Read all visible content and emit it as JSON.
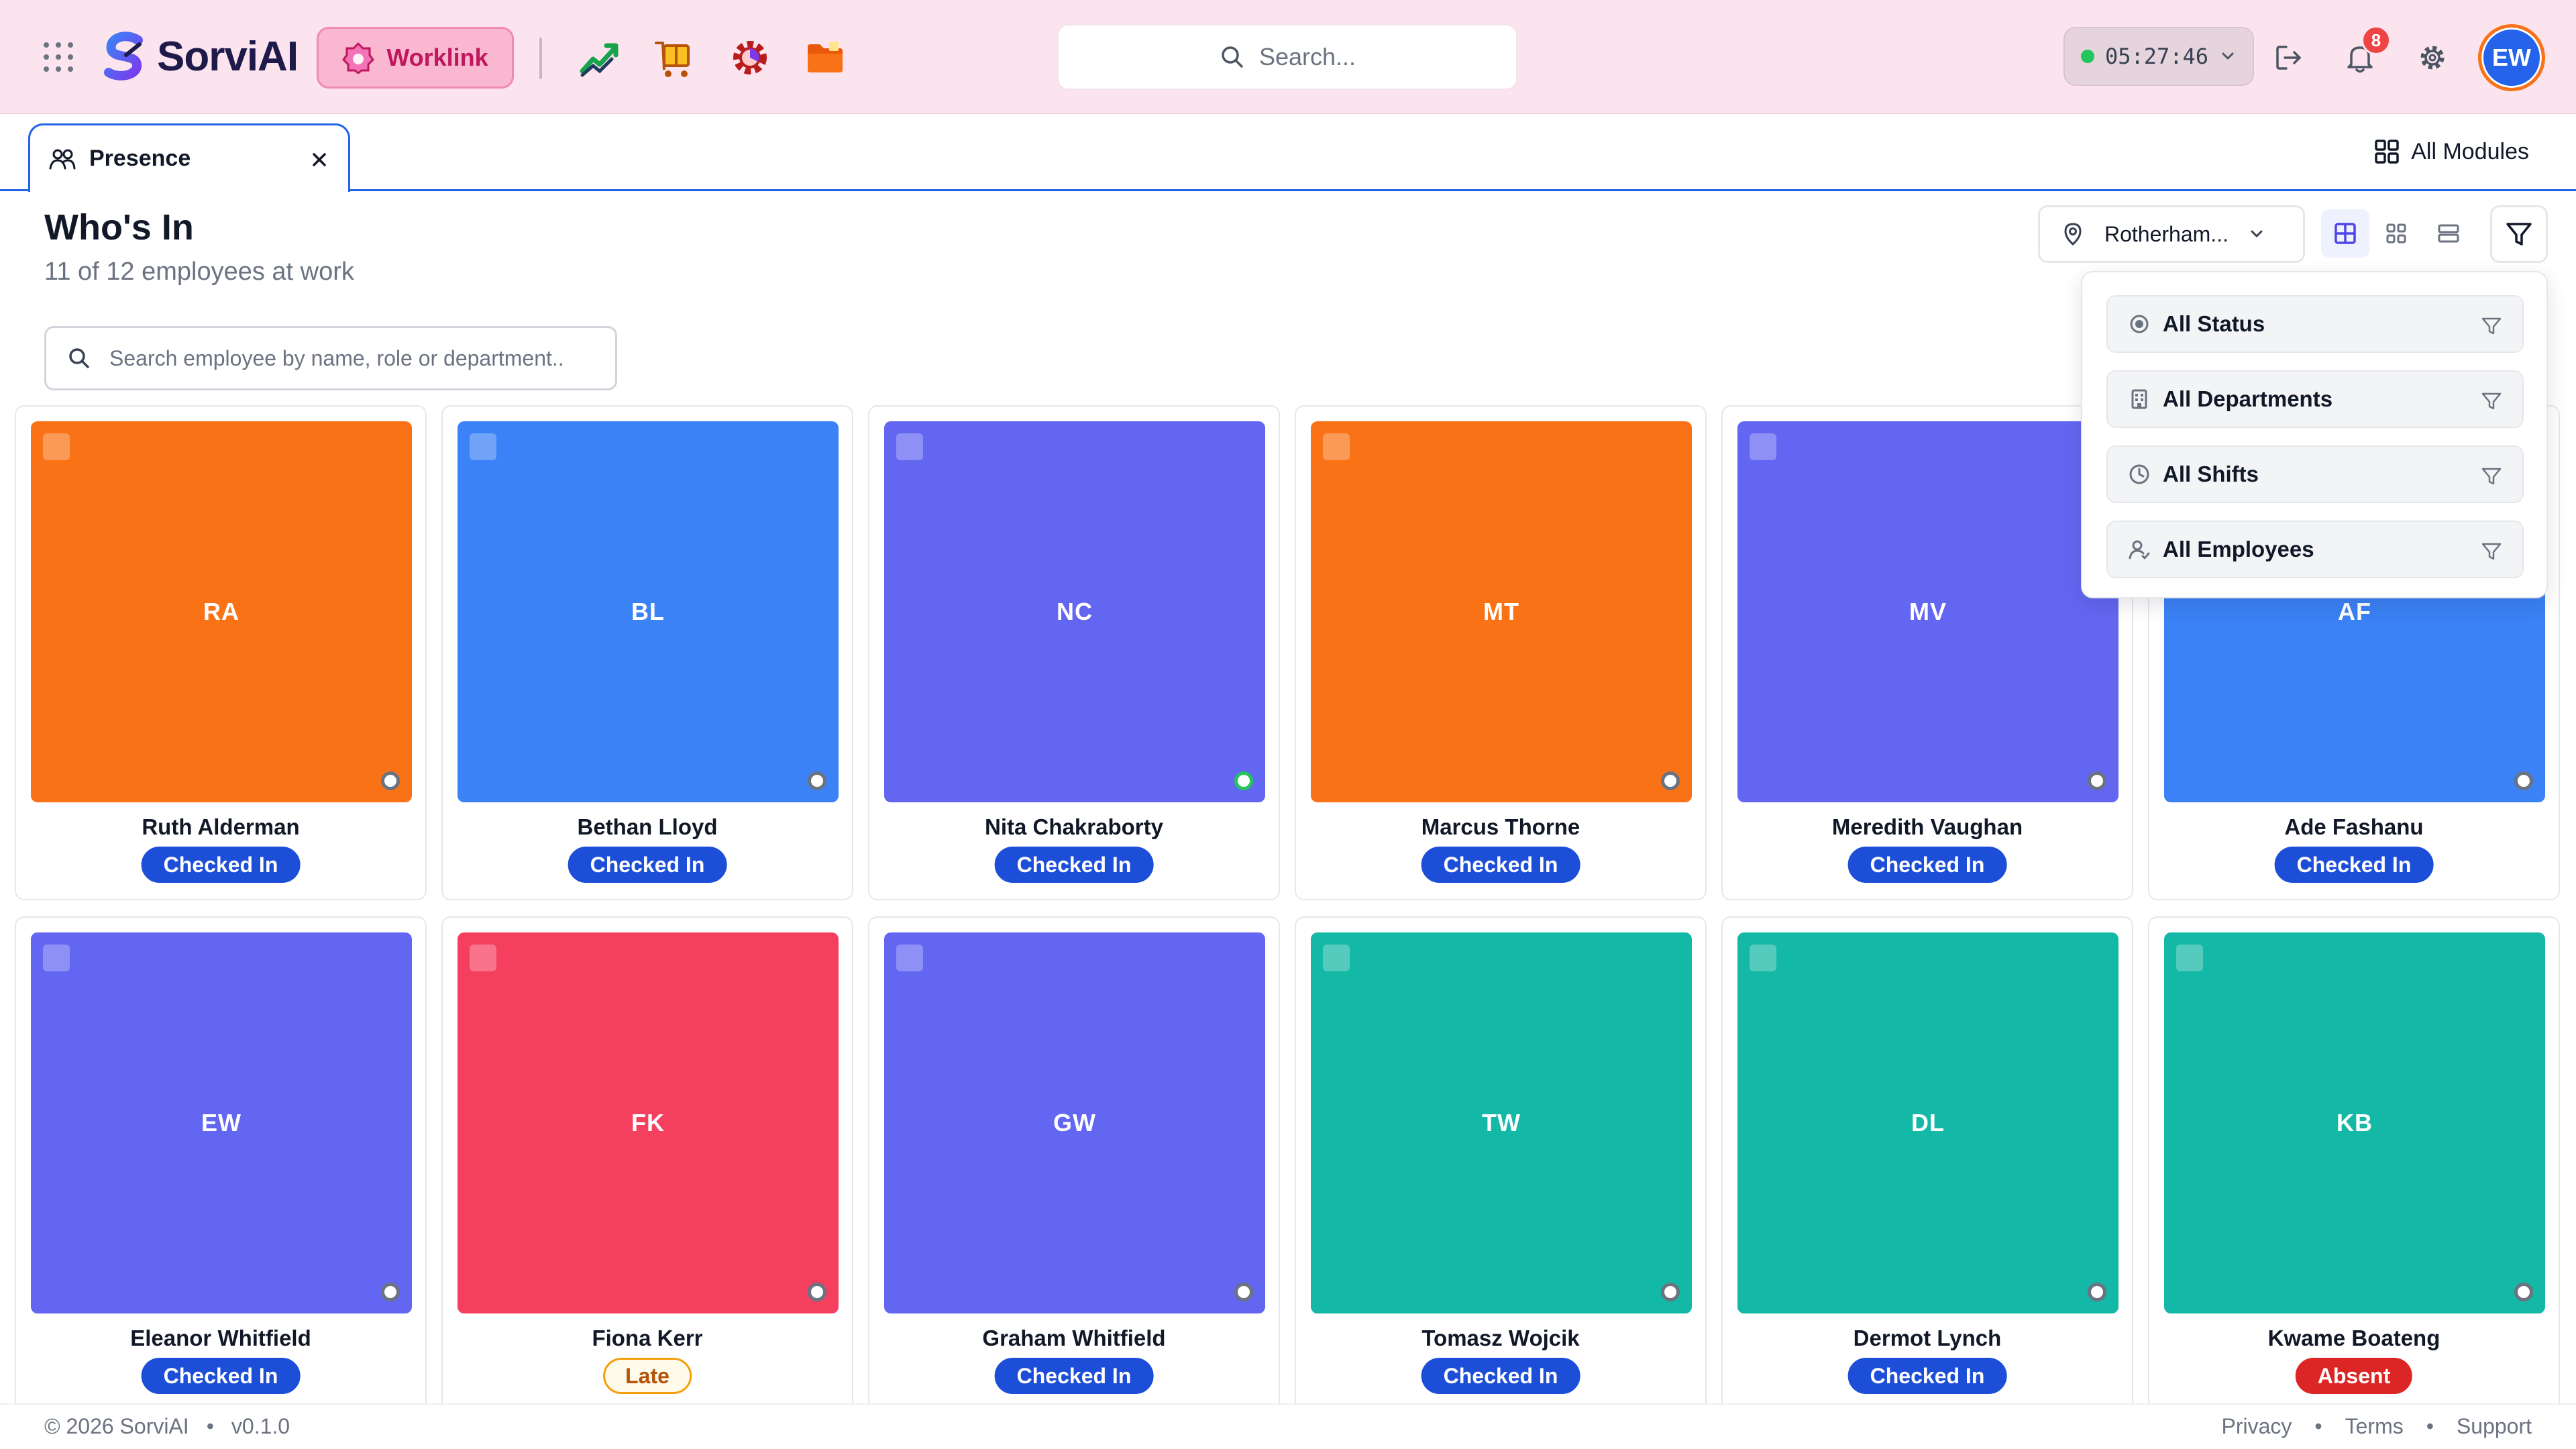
{
  "header": {
    "brand": "SorviAI",
    "worklink_label": "Worklink",
    "search_placeholder": "Search...",
    "clock": "05:27:46",
    "notification_count": "8",
    "user_initials": "EW",
    "app_icons": [
      "chart-growth-icon",
      "box-delivery-icon",
      "gear-analytics-icon",
      "folder-icon"
    ]
  },
  "tabs": {
    "active_label": "Presence",
    "all_modules_label": "All Modules"
  },
  "page": {
    "title": "Who's In",
    "subtitle": "11 of 12 employees at work",
    "search_placeholder": "Search employee by name, role or department..",
    "location_label": "Rotherham..."
  },
  "filters": [
    {
      "label": "All Status",
      "icon": "radio-icon"
    },
    {
      "label": "All Departments",
      "icon": "building-icon"
    },
    {
      "label": "All Shifts",
      "icon": "clock-icon"
    },
    {
      "label": "All Employees",
      "icon": "user-icon"
    }
  ],
  "employees": [
    {
      "initials": "RA",
      "name": "Ruth Alderman",
      "status": "Checked In",
      "color": "#f97316",
      "online": false
    },
    {
      "initials": "BL",
      "name": "Bethan Lloyd",
      "status": "Checked In",
      "color": "#3b82f6",
      "online": false
    },
    {
      "initials": "NC",
      "name": "Nita Chakraborty",
      "status": "Checked In",
      "color": "#6366f1",
      "online": true
    },
    {
      "initials": "MT",
      "name": "Marcus Thorne",
      "status": "Checked In",
      "color": "#f97316",
      "online": false
    },
    {
      "initials": "MV",
      "name": "Meredith Vaughan",
      "status": "Checked In",
      "color": "#6366f1",
      "online": false
    },
    {
      "initials": "AF",
      "name": "Ade Fashanu",
      "status": "Checked In",
      "color": "#3b82f6",
      "online": false
    },
    {
      "initials": "EW",
      "name": "Eleanor Whitfield",
      "status": "Checked In",
      "color": "#6366f1",
      "online": false
    },
    {
      "initials": "FK",
      "name": "Fiona Kerr",
      "status": "Late",
      "color": "#f43f5e",
      "online": false
    },
    {
      "initials": "GW",
      "name": "Graham Whitfield",
      "status": "Checked In",
      "color": "#6366f1",
      "online": false
    },
    {
      "initials": "TW",
      "name": "Tomasz Wojcik",
      "status": "Checked In",
      "color": "#14b8a6",
      "online": false
    },
    {
      "initials": "DL",
      "name": "Dermot Lynch",
      "status": "Checked In",
      "color": "#14b8a6",
      "online": false
    },
    {
      "initials": "KB",
      "name": "Kwame Boateng",
      "status": "Absent",
      "color": "#14b8a6",
      "online": false
    }
  ],
  "status_colors": {
    "Checked In": {
      "bg": "#1d4ed8",
      "fg": "#ffffff",
      "border": "#1d4ed8"
    },
    "Late": {
      "bg": "#fffbeb",
      "fg": "#b45309",
      "border": "#f59e0b"
    },
    "Absent": {
      "bg": "#dc2626",
      "fg": "#ffffff",
      "border": "#dc2626"
    }
  },
  "footer": {
    "copyright": "© 2026 SorviAI",
    "version": "v0.1.0",
    "links": [
      "Privacy",
      "Terms",
      "Support"
    ],
    "separator": "•"
  }
}
